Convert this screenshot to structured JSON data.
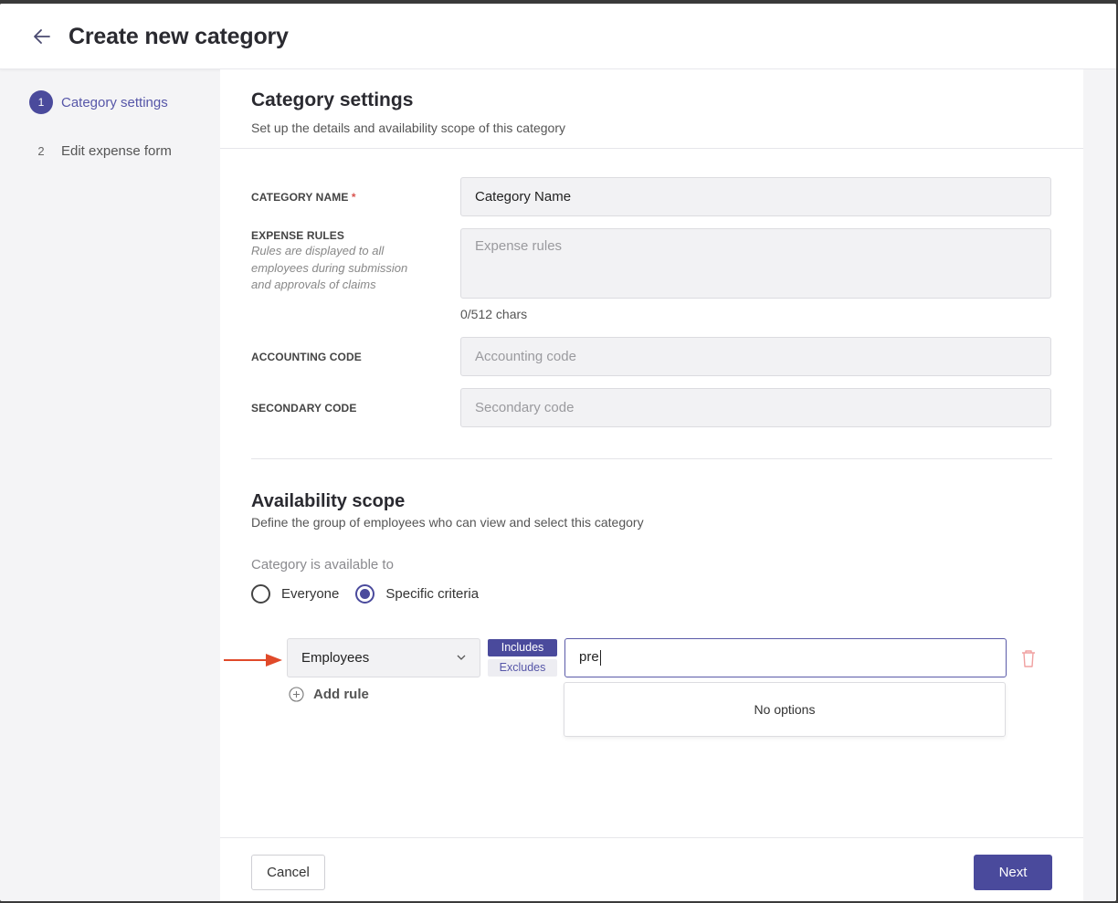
{
  "header": {
    "title": "Create new category"
  },
  "stepper": {
    "steps": [
      {
        "num": "1",
        "label": "Category settings"
      },
      {
        "num": "2",
        "label": "Edit expense form"
      }
    ]
  },
  "settings": {
    "title": "Category settings",
    "subtitle": "Set up the details and availability scope of this category",
    "category_name": {
      "label": "CATEGORY NAME",
      "required_mark": "*",
      "value": "Category Name"
    },
    "expense_rules": {
      "label": "EXPENSE RULES",
      "help": "Rules are displayed to all employees during submission and approvals of claims",
      "placeholder": "Expense rules",
      "char_count": "0/512 chars"
    },
    "accounting_code": {
      "label": "ACCOUNTING CODE",
      "placeholder": "Accounting code"
    },
    "secondary_code": {
      "label": "SECONDARY CODE",
      "placeholder": "Secondary code"
    }
  },
  "availability": {
    "title": "Availability scope",
    "subtitle": "Define the group of employees who can view and select this category",
    "available_to_label": "Category is available to",
    "options": {
      "everyone": "Everyone",
      "specific": "Specific criteria"
    },
    "selected": "specific",
    "rule": {
      "field": "Employees",
      "includes": "Includes",
      "excludes": "Excludes",
      "search_value": "pre",
      "dropdown_message": "No options"
    },
    "add_rule": "Add rule"
  },
  "footer": {
    "cancel": "Cancel",
    "next": "Next"
  },
  "colors": {
    "accent": "#4a4a9c",
    "delete": "#f0a0a0",
    "annotation": "#e04a2a"
  }
}
